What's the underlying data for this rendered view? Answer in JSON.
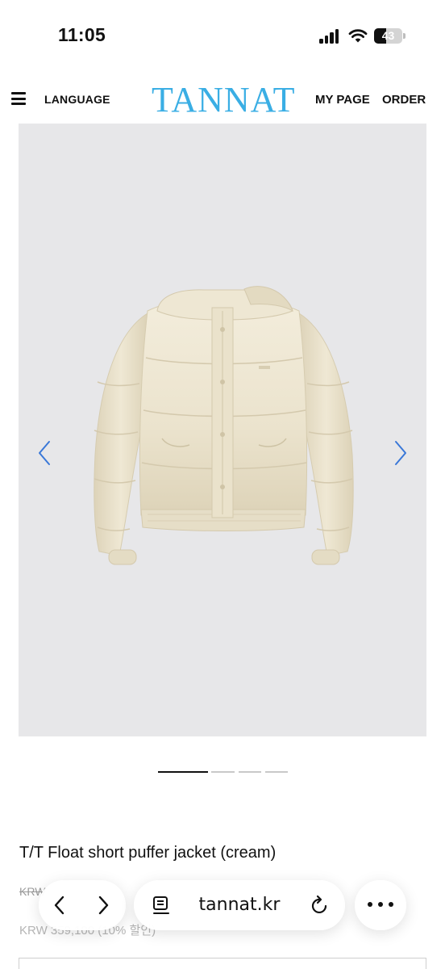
{
  "status_bar": {
    "time": "11:05",
    "battery_level": "43",
    "icons": [
      "signal-icon",
      "wifi-icon",
      "battery-icon"
    ]
  },
  "header": {
    "language_label": "LANGUAGE",
    "brand": "TANNAT",
    "my_page_label": "MY PAGE",
    "order_label": "ORDER",
    "brand_color": "#3aaee4",
    "icons": [
      "menu-icon"
    ]
  },
  "carousel": {
    "slide_count": 4,
    "active_slide": 1,
    "arrow_color": "#3a78d8",
    "image_subject": "cream-puffer-jacket",
    "icons": [
      "chevron-left-icon",
      "chevron-right-icon"
    ]
  },
  "product": {
    "name": "T/T Float short puffer jacket (cream)",
    "original_price": "KRW",
    "sale_price": "KRW 359,100 (10% 할인)"
  },
  "browser": {
    "url": "tannat.kr",
    "icons": [
      "back-icon",
      "forward-icon",
      "reader-icon",
      "reload-icon",
      "more-icon"
    ]
  }
}
